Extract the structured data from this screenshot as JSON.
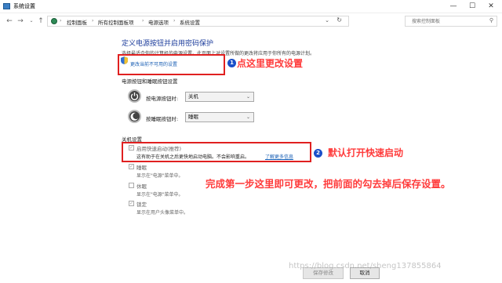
{
  "window": {
    "title": "系统设置"
  },
  "address": {
    "crumbs": [
      "控制面板",
      "所有控制面板项",
      "电源选项",
      "系统设置"
    ],
    "search_placeholder": "搜索控制面板"
  },
  "content": {
    "heading": "定义电源按钮并启用密码保护",
    "description": "选择最适合你的计算机的电源设置。此页面上对设置所做的更改将应用于你所有的电源计划。",
    "change_link": "更改当前不可用的设置",
    "section_buttons": "电源按钮和睡眠按钮设置",
    "power_button_label": "按电源按钮时:",
    "power_button_value": "关机",
    "sleep_button_label": "按睡眠按钮时:",
    "sleep_button_value": "睡眠",
    "section_shutdown": "关机设置",
    "fast_startup_label": "启用快速启动(推荐)",
    "fast_startup_desc": "这有助于在关机之后更快地启动电脑。不会影响重启。",
    "learn_more": "了解更多信息",
    "sleep_label": "睡眠",
    "sleep_desc": "显示在\"电源\"菜单中。",
    "hibernate_label": "休眠",
    "hibernate_desc": "显示在\"电源\"菜单中。",
    "lock_label": "锁定",
    "lock_desc": "显示在用户头像菜单中。",
    "save_label": "保存修改",
    "cancel_label": "取消"
  },
  "annotations": {
    "n1": "1",
    "a1": "点这里更改设置",
    "n2": "2",
    "a2": "默认打开快速启动",
    "a3": "完成第一步这里即可更改，把前面的勾去掉后保存设置。"
  },
  "watermark": "https://blog.csdn.net/sheng137855864",
  "icons": {
    "back": "back-arrow-icon",
    "forward": "forward-arrow-icon",
    "up": "up-arrow-icon",
    "refresh": "refresh-icon",
    "search": "search-icon",
    "shield": "uac-shield-icon",
    "power": "power-button-icon",
    "sleep": "sleep-moon-icon"
  },
  "colors": {
    "accent": "#1e3e9c",
    "link": "#1a5fb4",
    "annotation": "#ff3b3b",
    "badge": "#1a4fc9",
    "box": "#e02020"
  }
}
